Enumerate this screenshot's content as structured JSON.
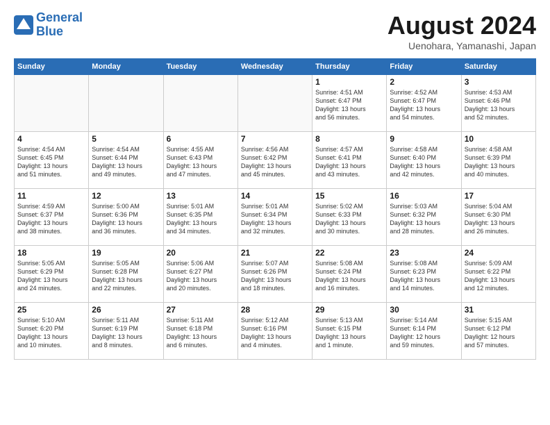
{
  "header": {
    "logo_line1": "General",
    "logo_line2": "Blue",
    "month": "August 2024",
    "location": "Uenohara, Yamanashi, Japan"
  },
  "weekdays": [
    "Sunday",
    "Monday",
    "Tuesday",
    "Wednesday",
    "Thursday",
    "Friday",
    "Saturday"
  ],
  "weeks": [
    [
      {
        "day": "",
        "info": ""
      },
      {
        "day": "",
        "info": ""
      },
      {
        "day": "",
        "info": ""
      },
      {
        "day": "",
        "info": ""
      },
      {
        "day": "1",
        "info": "Sunrise: 4:51 AM\nSunset: 6:47 PM\nDaylight: 13 hours\nand 56 minutes."
      },
      {
        "day": "2",
        "info": "Sunrise: 4:52 AM\nSunset: 6:47 PM\nDaylight: 13 hours\nand 54 minutes."
      },
      {
        "day": "3",
        "info": "Sunrise: 4:53 AM\nSunset: 6:46 PM\nDaylight: 13 hours\nand 52 minutes."
      }
    ],
    [
      {
        "day": "4",
        "info": "Sunrise: 4:54 AM\nSunset: 6:45 PM\nDaylight: 13 hours\nand 51 minutes."
      },
      {
        "day": "5",
        "info": "Sunrise: 4:54 AM\nSunset: 6:44 PM\nDaylight: 13 hours\nand 49 minutes."
      },
      {
        "day": "6",
        "info": "Sunrise: 4:55 AM\nSunset: 6:43 PM\nDaylight: 13 hours\nand 47 minutes."
      },
      {
        "day": "7",
        "info": "Sunrise: 4:56 AM\nSunset: 6:42 PM\nDaylight: 13 hours\nand 45 minutes."
      },
      {
        "day": "8",
        "info": "Sunrise: 4:57 AM\nSunset: 6:41 PM\nDaylight: 13 hours\nand 43 minutes."
      },
      {
        "day": "9",
        "info": "Sunrise: 4:58 AM\nSunset: 6:40 PM\nDaylight: 13 hours\nand 42 minutes."
      },
      {
        "day": "10",
        "info": "Sunrise: 4:58 AM\nSunset: 6:39 PM\nDaylight: 13 hours\nand 40 minutes."
      }
    ],
    [
      {
        "day": "11",
        "info": "Sunrise: 4:59 AM\nSunset: 6:37 PM\nDaylight: 13 hours\nand 38 minutes."
      },
      {
        "day": "12",
        "info": "Sunrise: 5:00 AM\nSunset: 6:36 PM\nDaylight: 13 hours\nand 36 minutes."
      },
      {
        "day": "13",
        "info": "Sunrise: 5:01 AM\nSunset: 6:35 PM\nDaylight: 13 hours\nand 34 minutes."
      },
      {
        "day": "14",
        "info": "Sunrise: 5:01 AM\nSunset: 6:34 PM\nDaylight: 13 hours\nand 32 minutes."
      },
      {
        "day": "15",
        "info": "Sunrise: 5:02 AM\nSunset: 6:33 PM\nDaylight: 13 hours\nand 30 minutes."
      },
      {
        "day": "16",
        "info": "Sunrise: 5:03 AM\nSunset: 6:32 PM\nDaylight: 13 hours\nand 28 minutes."
      },
      {
        "day": "17",
        "info": "Sunrise: 5:04 AM\nSunset: 6:30 PM\nDaylight: 13 hours\nand 26 minutes."
      }
    ],
    [
      {
        "day": "18",
        "info": "Sunrise: 5:05 AM\nSunset: 6:29 PM\nDaylight: 13 hours\nand 24 minutes."
      },
      {
        "day": "19",
        "info": "Sunrise: 5:05 AM\nSunset: 6:28 PM\nDaylight: 13 hours\nand 22 minutes."
      },
      {
        "day": "20",
        "info": "Sunrise: 5:06 AM\nSunset: 6:27 PM\nDaylight: 13 hours\nand 20 minutes."
      },
      {
        "day": "21",
        "info": "Sunrise: 5:07 AM\nSunset: 6:26 PM\nDaylight: 13 hours\nand 18 minutes."
      },
      {
        "day": "22",
        "info": "Sunrise: 5:08 AM\nSunset: 6:24 PM\nDaylight: 13 hours\nand 16 minutes."
      },
      {
        "day": "23",
        "info": "Sunrise: 5:08 AM\nSunset: 6:23 PM\nDaylight: 13 hours\nand 14 minutes."
      },
      {
        "day": "24",
        "info": "Sunrise: 5:09 AM\nSunset: 6:22 PM\nDaylight: 13 hours\nand 12 minutes."
      }
    ],
    [
      {
        "day": "25",
        "info": "Sunrise: 5:10 AM\nSunset: 6:20 PM\nDaylight: 13 hours\nand 10 minutes."
      },
      {
        "day": "26",
        "info": "Sunrise: 5:11 AM\nSunset: 6:19 PM\nDaylight: 13 hours\nand 8 minutes."
      },
      {
        "day": "27",
        "info": "Sunrise: 5:11 AM\nSunset: 6:18 PM\nDaylight: 13 hours\nand 6 minutes."
      },
      {
        "day": "28",
        "info": "Sunrise: 5:12 AM\nSunset: 6:16 PM\nDaylight: 13 hours\nand 4 minutes."
      },
      {
        "day": "29",
        "info": "Sunrise: 5:13 AM\nSunset: 6:15 PM\nDaylight: 13 hours\nand 1 minute."
      },
      {
        "day": "30",
        "info": "Sunrise: 5:14 AM\nSunset: 6:14 PM\nDaylight: 12 hours\nand 59 minutes."
      },
      {
        "day": "31",
        "info": "Sunrise: 5:15 AM\nSunset: 6:12 PM\nDaylight: 12 hours\nand 57 minutes."
      }
    ]
  ]
}
